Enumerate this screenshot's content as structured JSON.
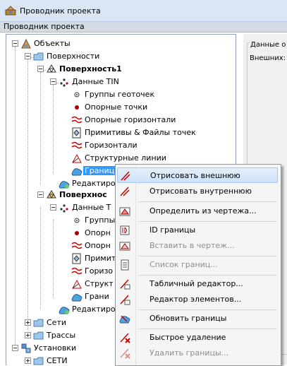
{
  "window": {
    "title": "Проводник проекта"
  },
  "tab": {
    "label": "Проводник проекта"
  },
  "right_panel": {
    "group_label": "Данные о",
    "field_label": "Внешних:"
  },
  "tree": {
    "objects": "Объекты",
    "surfaces": "Поверхности",
    "surface1": "Поверхность1",
    "tin_data": "Данные TIN",
    "point_groups": "Группы геоточек",
    "control_points": "Опорные точки",
    "control_contours": "Опорные горизонтали",
    "primitives_files": "Примитивы & Файлы точек",
    "contours": "Горизонтали",
    "breaklines": "Структурные линии",
    "boundaries": "Границ",
    "editor1": "Редактиро",
    "surface2": "Поверхнос",
    "tin_data2": "Данные T",
    "group2": "Группы",
    "control2": "Опорн",
    "control_c2": "Опорн",
    "prim2": "Примити",
    "contours2": "Горизо",
    "struct2": "Структ",
    "bound2": "Грани",
    "editor2": "Редактиро",
    "networks": "Сети",
    "routes": "Трассы",
    "settings": "Установки",
    "networks2": "СЕТИ"
  },
  "context_menu": {
    "items": [
      {
        "label": "Отрисовать внешнюю",
        "enabled": true
      },
      {
        "label": "Отрисовать внутреннюю",
        "enabled": true
      },
      {
        "label": "Определить из чертежа...",
        "enabled": true
      },
      {
        "label": "ID границы",
        "enabled": true
      },
      {
        "label": "Вставить в чертеж...",
        "enabled": false
      },
      {
        "label": "Список границ...",
        "enabled": false
      },
      {
        "label": "Табличный редактор...",
        "enabled": true
      },
      {
        "label": "Редактор элементов...",
        "enabled": true
      },
      {
        "label": "Обновить границы",
        "enabled": true
      },
      {
        "label": "Быстрое удаление",
        "enabled": true
      },
      {
        "label": "Удалить границы...",
        "enabled": false
      }
    ]
  },
  "colors": {
    "selection": "#3399ff",
    "menu_highlight": "#cfe2f8",
    "disabled_text": "#8d8d8d"
  }
}
